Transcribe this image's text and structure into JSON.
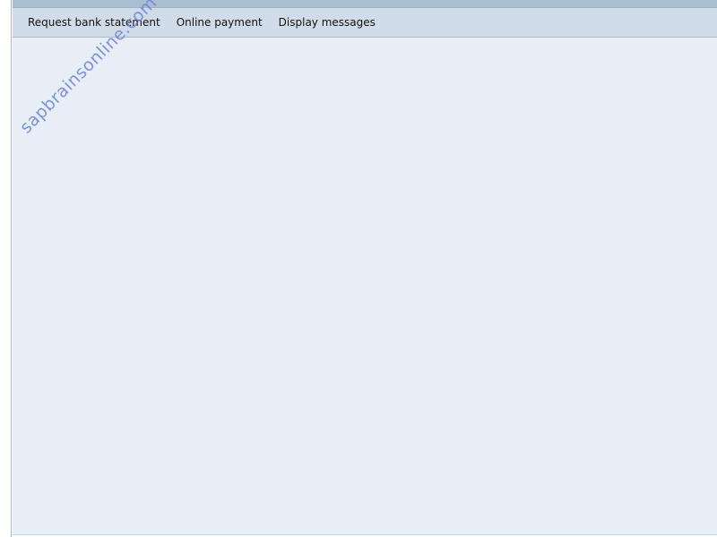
{
  "toolbar": {
    "buttons": [
      {
        "label": "Request bank statement"
      },
      {
        "label": "Online payment"
      },
      {
        "label": "Display messages"
      }
    ]
  },
  "watermark": {
    "text": "sapbrainsonline.com"
  },
  "colors": {
    "toolbar_bg": "#d0dde8",
    "content_bg": "#e7eef6",
    "title_strip": "#a9bed2",
    "watermark": "#7080d8"
  }
}
